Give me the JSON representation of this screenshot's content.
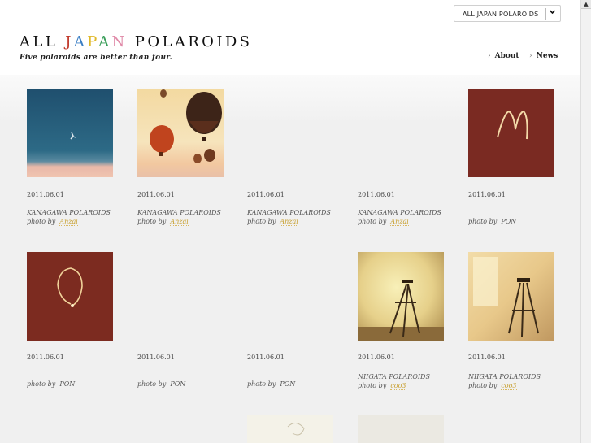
{
  "header": {
    "logo_parts": [
      {
        "text": "ALL ",
        "color": "#111111"
      },
      {
        "text": "J",
        "color": "#c0392b"
      },
      {
        "text": "A",
        "color": "#3a7ec4"
      },
      {
        "text": "P",
        "color": "#e0b92a"
      },
      {
        "text": "A",
        "color": "#3a9e5a"
      },
      {
        "text": "N",
        "color": "#e08aa8"
      },
      {
        "text": " POLAROIDS",
        "color": "#111111"
      }
    ],
    "tagline": "Five polaroids are better than four.",
    "region_select": "ALL JAPAN POLAROIDS",
    "nav": [
      {
        "label": "About"
      },
      {
        "label": "News"
      }
    ]
  },
  "items": [
    {
      "date": "2011.06.01",
      "title": "KANAGAWA POLAROIDS",
      "by": "photo by",
      "author": "Anzai",
      "author_link": true,
      "image": "sky-bird-photo"
    },
    {
      "date": "2011.06.01",
      "title": "KANAGAWA POLAROIDS",
      "by": "photo by",
      "author": "Anzai",
      "author_link": true,
      "image": "hot-air-balloons-photo"
    },
    {
      "date": "2011.06.01",
      "title": "KANAGAWA POLAROIDS",
      "by": "photo by",
      "author": "Anzai",
      "author_link": true,
      "image": ""
    },
    {
      "date": "2011.06.01",
      "title": "KANAGAWA POLAROIDS",
      "by": "photo by",
      "author": "Anzai",
      "author_link": true,
      "image": ""
    },
    {
      "date": "2011.06.01",
      "title": "",
      "by": "photo by",
      "author": "PON",
      "author_link": false,
      "image": "light-letter-m-photo"
    },
    {
      "date": "2011.06.01",
      "title": "",
      "by": "photo by",
      "author": "PON",
      "author_link": false,
      "image": "light-letter-o-photo"
    },
    {
      "date": "2011.06.01",
      "title": "",
      "by": "photo by",
      "author": "PON",
      "author_link": false,
      "image": ""
    },
    {
      "date": "2011.06.01",
      "title": "",
      "by": "photo by",
      "author": "PON",
      "author_link": false,
      "image": ""
    },
    {
      "date": "2011.06.01",
      "title": "NIIGATA POLAROIDS",
      "by": "photo by",
      "author": "coo3",
      "author_link": true,
      "image": "easel-photo"
    },
    {
      "date": "2011.06.01",
      "title": "NIIGATA POLAROIDS",
      "by": "photo by",
      "author": "coo3",
      "author_link": true,
      "image": "easel-window-photo"
    }
  ],
  "partial_row": [
    {
      "image": "light-trail-photo"
    },
    {
      "image": "pale-photo"
    }
  ],
  "colors": {
    "author_link": "#c8a030",
    "background": "#f0f0f0"
  }
}
